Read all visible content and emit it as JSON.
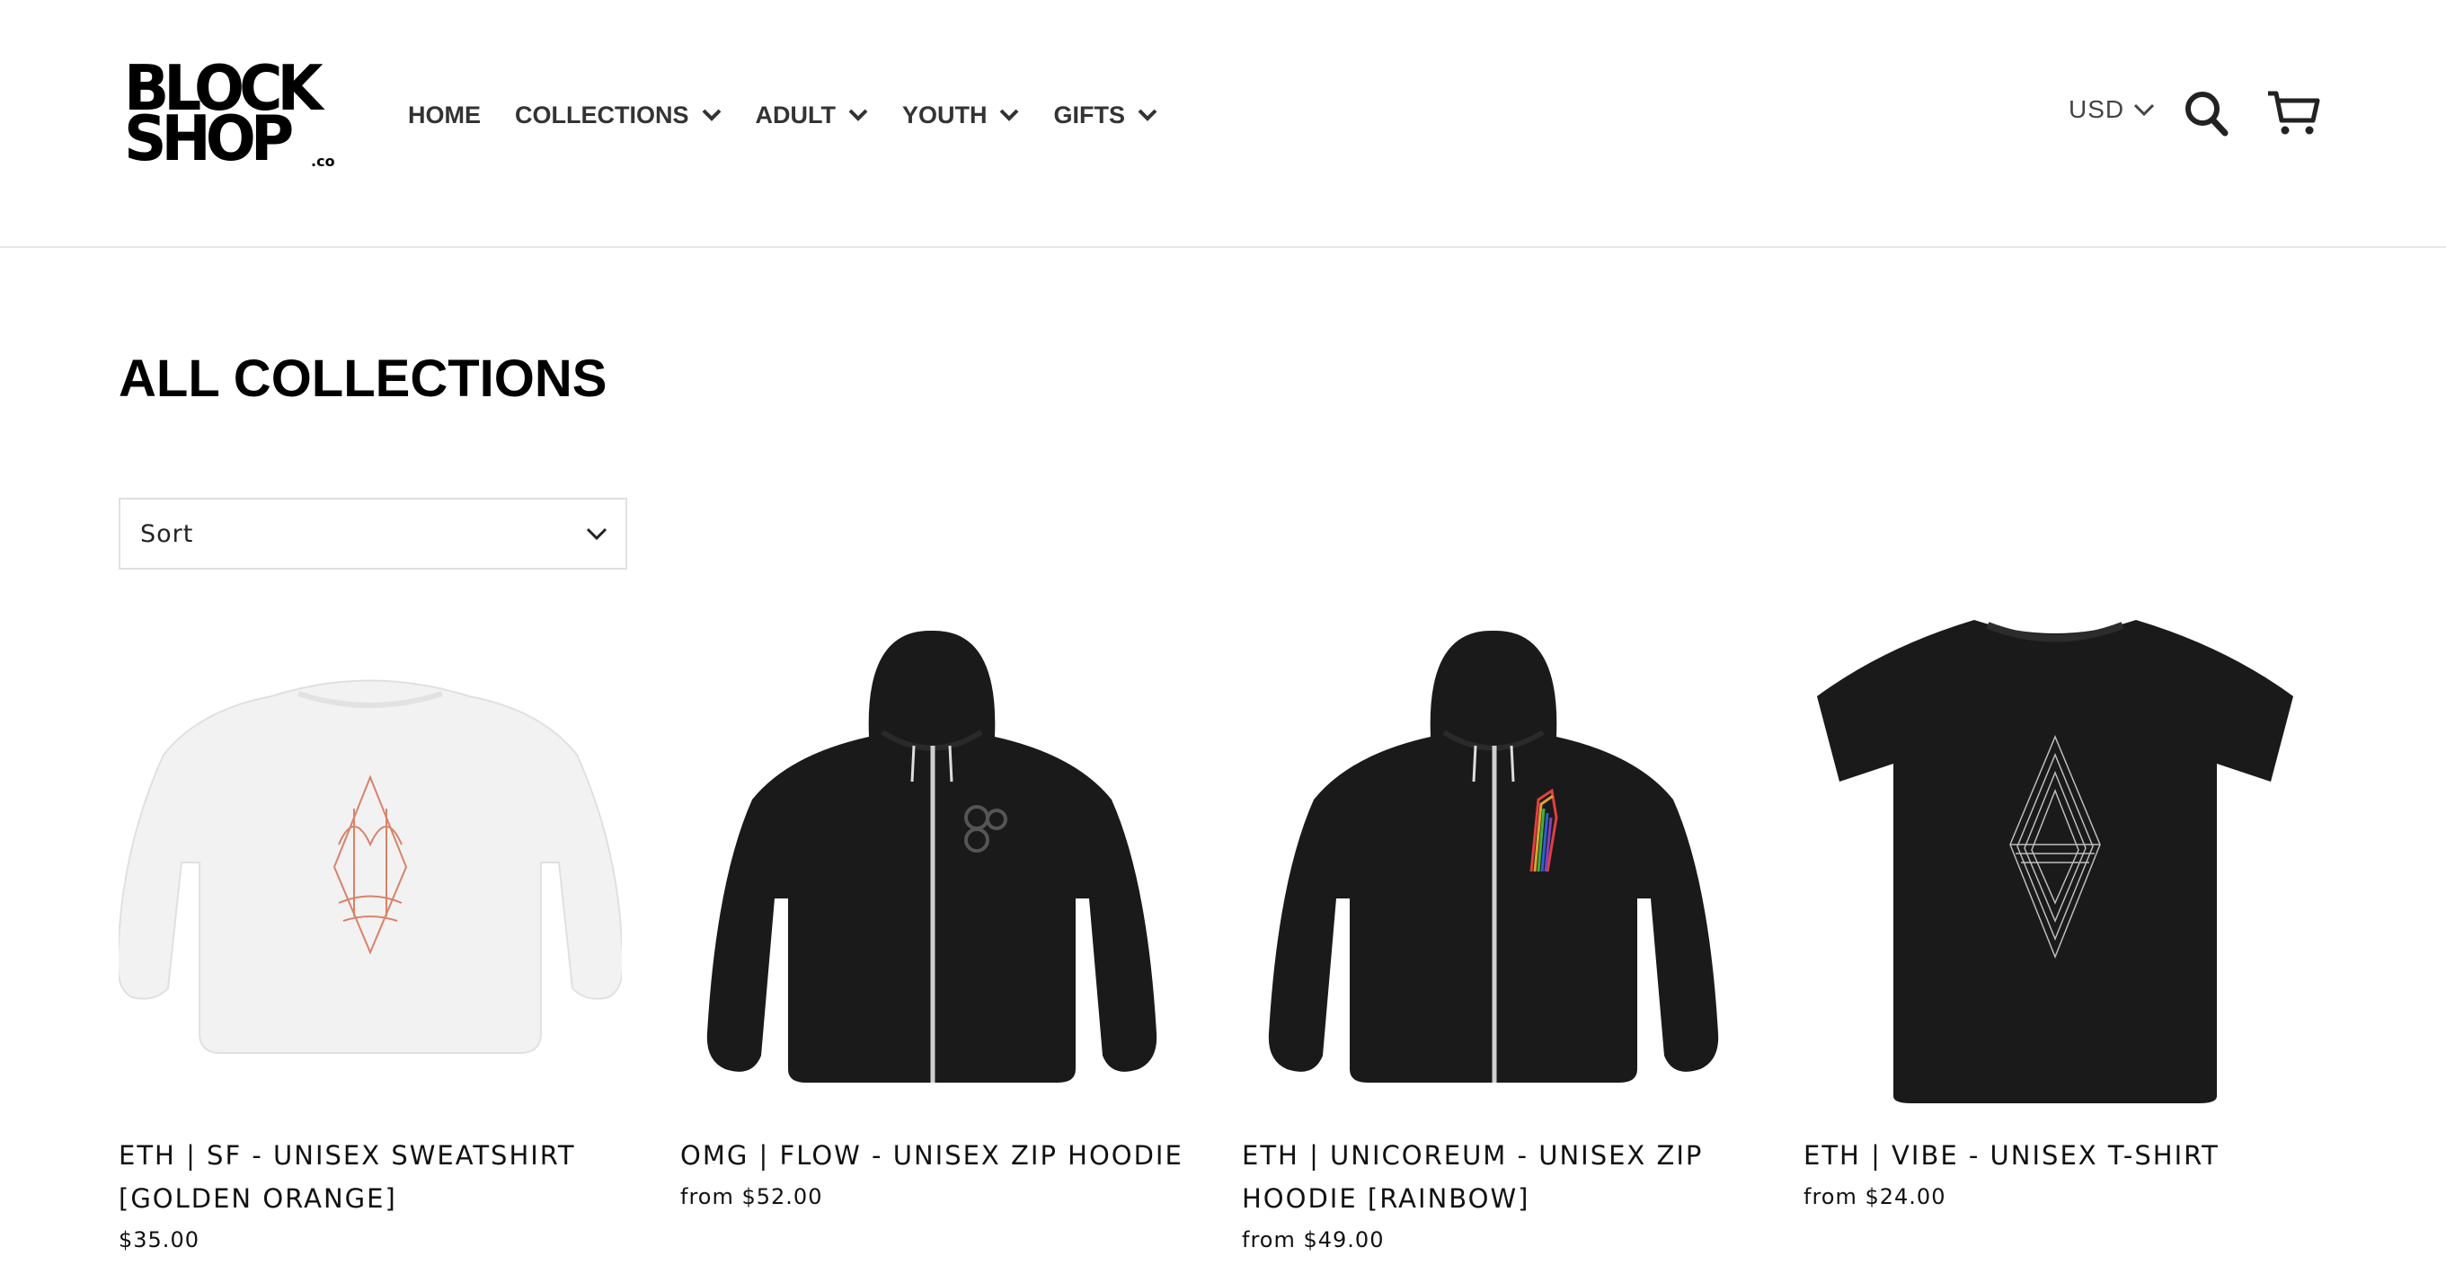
{
  "header": {
    "logo_line1": "BLOCK",
    "logo_line2": "SHOP",
    "logo_suffix": ".co",
    "nav": [
      {
        "label": "HOME",
        "has_dropdown": false
      },
      {
        "label": "COLLECTIONS",
        "has_dropdown": true
      },
      {
        "label": "ADULT",
        "has_dropdown": true
      },
      {
        "label": "YOUTH",
        "has_dropdown": true
      },
      {
        "label": "GIFTS",
        "has_dropdown": true
      }
    ],
    "currency": "USD",
    "icons": [
      "search-icon",
      "cart-icon",
      "chevron-down-icon"
    ]
  },
  "main": {
    "title": "ALL COLLECTIONS",
    "sort_label": "Sort"
  },
  "products": [
    {
      "title": "ETH | SF - UNISEX SWEATSHIRT [GOLDEN ORANGE]",
      "price": "$35.00",
      "image": "white sweatshirt with golden gate ethereum print"
    },
    {
      "title": "OMG | FLOW - UNISEX ZIP HOODIE",
      "price": "from $52.00",
      "image": "black zip hoodie with omg logo"
    },
    {
      "title": "ETH | UNICOREUM - UNISEX ZIP HOODIE [RAINBOW]",
      "price": "from $49.00",
      "image": "black zip hoodie with rainbow unicorn"
    },
    {
      "title": "ETH | VIBE - UNISEX T-SHIRT",
      "price": "from $24.00",
      "image": "black t-shirt with ethereum diamond"
    }
  ],
  "colors": {
    "text": "#000000",
    "nav_text": "#333333",
    "border": "#e8e8e8",
    "garment_dark": "#1a1a1a",
    "garment_light": "#f2f2f2",
    "print_orange": "#d9826a"
  }
}
